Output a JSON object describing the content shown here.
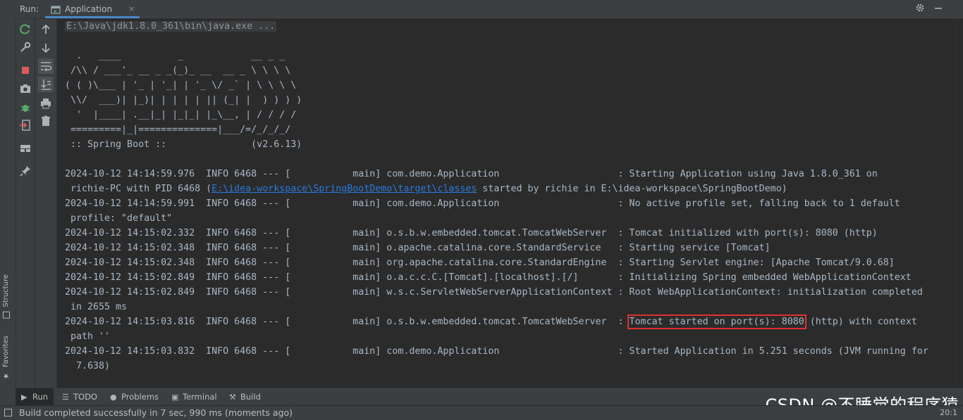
{
  "header": {
    "run_label": "Run:",
    "tab_label": "Application",
    "tab_close": "×"
  },
  "left_strip": {
    "structure_label": "Structure",
    "favorites_label": "Favorites"
  },
  "toolbar_icons": [
    "rerun-icon",
    "wrench-icon",
    "stop-icon",
    "camera-icon",
    "debug-bug-icon",
    "exit-icon",
    "layout-icon",
    "pin-icon",
    "up-arrow-icon",
    "down-arrow-icon",
    "soft-wrap-icon",
    "scroll-to-end-icon",
    "print-icon",
    "trash-icon"
  ],
  "console": {
    "command_line": "E:\\Java\\jdk1.8.0_361\\bin\\java.exe ...",
    "banner": [
      "  .   ____          _            __ _ _",
      " /\\\\ / ___'_ __ _ _(_)_ __  __ _ \\ \\ \\ \\",
      "( ( )\\___ | '_ | '_| | '_ \\/ _` | \\ \\ \\ \\",
      " \\\\/  ___)| |_)| | | | | || (_| |  ) ) ) )",
      "  '  |____| .__|_| |_|_| |_\\__, | / / / /",
      " =========|_|==============|___/=/_/_/_/",
      " :: Spring Boot ::               (v2.6.13)"
    ],
    "logs": [
      {
        "prefix": "2024-10-12 14:14:59.976  INFO 6468 --- [           main] com.demo.Application                     : ",
        "message": "Starting Application using Java 1.8.0_361 on",
        "cont_pre": " richie-PC with PID 6468 (",
        "cont_link": "E:\\idea-workspace\\SpringBootDemo\\target\\classes",
        "cont_post": " started by richie in E:\\idea-workspace\\SpringBootDemo)"
      },
      {
        "prefix": "2024-10-12 14:14:59.991  INFO 6468 --- [           main] com.demo.Application                     : ",
        "message": "No active profile set, falling back to 1 default",
        "cont": " profile: \"default\""
      },
      {
        "prefix": "2024-10-12 14:15:02.332  INFO 6468 --- [           main] o.s.b.w.embedded.tomcat.TomcatWebServer  : ",
        "message": "Tomcat initialized with port(s): 8080 (http)"
      },
      {
        "prefix": "2024-10-12 14:15:02.348  INFO 6468 --- [           main] o.apache.catalina.core.StandardService   : ",
        "message": "Starting service [Tomcat]"
      },
      {
        "prefix": "2024-10-12 14:15:02.348  INFO 6468 --- [           main] org.apache.catalina.core.StandardEngine  : ",
        "message": "Starting Servlet engine: [Apache Tomcat/9.0.68]"
      },
      {
        "prefix": "2024-10-12 14:15:02.849  INFO 6468 --- [           main] o.a.c.c.C.[Tomcat].[localhost].[/]       : ",
        "message": "Initializing Spring embedded WebApplicationContext"
      },
      {
        "prefix": "2024-10-12 14:15:02.849  INFO 6468 --- [           main] w.s.c.ServletWebServerApplicationContext : ",
        "message": "Root WebApplicationContext: initialization completed",
        "cont": " in 2655 ms"
      },
      {
        "prefix": "2024-10-12 14:15:03.816  INFO 6468 --- [           main] o.s.b.w.embedded.tomcat.TomcatWebServer  : ",
        "message_highlight": "Tomcat started on port(s): 8080",
        "message_rest": " (http) with context",
        "cont": " path ''"
      },
      {
        "prefix": "2024-10-12 14:15:03.832  INFO 6468 --- [           main] com.demo.Application                     : ",
        "message": "Started Application in 5.251 seconds (JVM running for",
        "cont": "  7.638)"
      }
    ]
  },
  "bottom_tabs": [
    {
      "label": "Run",
      "icon": "▶"
    },
    {
      "label": "TODO",
      "icon": "☰"
    },
    {
      "label": "Problems",
      "icon": "●"
    },
    {
      "label": "Terminal",
      "icon": "▣"
    },
    {
      "label": "Build",
      "icon": "⚒"
    }
  ],
  "status": {
    "message": "Build completed successfully in 7 sec, 990 ms (moments ago)",
    "caret": "20:1"
  },
  "watermark": "CSDN @不睡觉的程序猿",
  "colors": {
    "console_bg": "#2b2b2b",
    "panel_bg": "#3c3f41",
    "text": "#a9b7c6",
    "link": "#287bde",
    "highlight_box": "#e03030",
    "accent": "#4a88c7"
  }
}
